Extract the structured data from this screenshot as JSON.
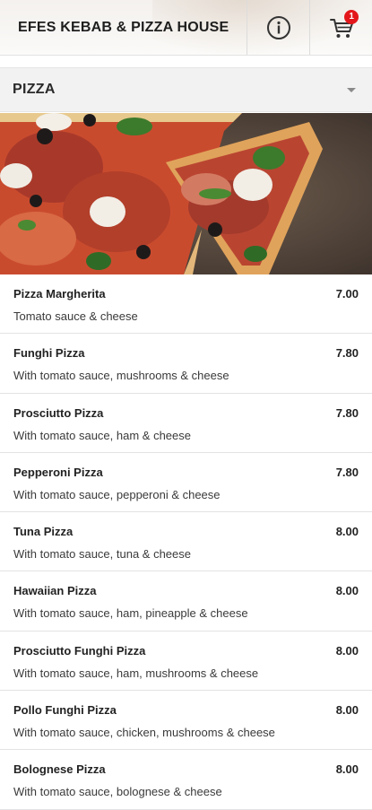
{
  "header": {
    "title": "EFES KEBAB & PIZZA HOUSE",
    "info_icon": "info-icon",
    "cart_icon": "cart-icon",
    "cart_count": "1"
  },
  "category": {
    "title": "PIZZA",
    "expand_icon": "chevron-down-icon"
  },
  "menu": {
    "items": [
      {
        "name": "Pizza Margherita",
        "price": "7.00",
        "desc": "Tomato sauce & cheese"
      },
      {
        "name": "Funghi Pizza",
        "price": "7.80",
        "desc": "With tomato sauce, mushrooms & cheese"
      },
      {
        "name": "Prosciutto Pizza",
        "price": "7.80",
        "desc": "With tomato sauce, ham & cheese"
      },
      {
        "name": "Pepperoni Pizza",
        "price": "7.80",
        "desc": "With tomato sauce, pepperoni & cheese"
      },
      {
        "name": "Tuna Pizza",
        "price": "8.00",
        "desc": "With tomato sauce, tuna & cheese"
      },
      {
        "name": "Hawaiian Pizza",
        "price": "8.00",
        "desc": "With tomato sauce, ham, pineapple & cheese"
      },
      {
        "name": "Prosciutto Funghi Pizza",
        "price": "8.00",
        "desc": "With tomato sauce, ham, mushrooms & cheese"
      },
      {
        "name": "Pollo Funghi Pizza",
        "price": "8.00",
        "desc": "With tomato sauce, chicken, mushrooms & cheese"
      },
      {
        "name": "Bolognese Pizza",
        "price": "8.00",
        "desc": "With tomato sauce, bolognese & cheese"
      }
    ]
  },
  "colors": {
    "badge": "#e3171b",
    "category_bg": "#f2f2f2"
  }
}
